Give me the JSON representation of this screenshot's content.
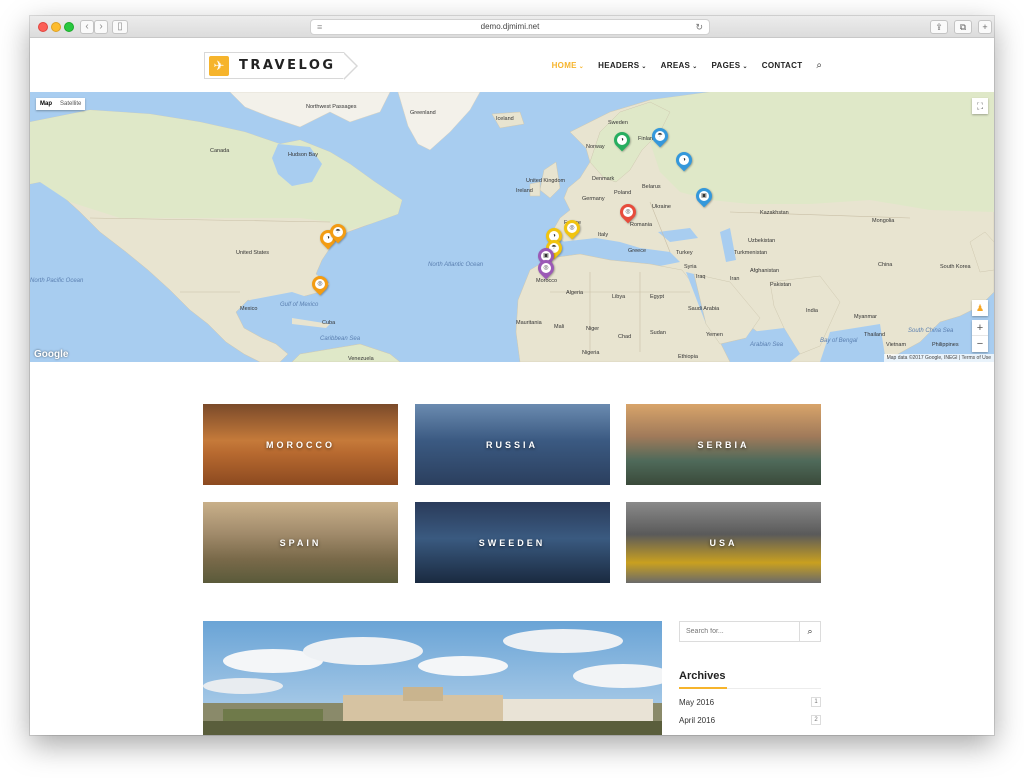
{
  "browser": {
    "url": "demo.djmimi.net"
  },
  "site": {
    "logo_text": "TRAVELOG",
    "nav": [
      {
        "label": "HOME",
        "has_menu": true,
        "active": true
      },
      {
        "label": "HEADERS",
        "has_menu": true,
        "active": false
      },
      {
        "label": "AREAS",
        "has_menu": true,
        "active": false
      },
      {
        "label": "PAGES",
        "has_menu": true,
        "active": false
      },
      {
        "label": "CONTACT",
        "has_menu": false,
        "active": false
      }
    ],
    "accent_color": "#f6b42c"
  },
  "map": {
    "type_controls": [
      "Map",
      "Satellite"
    ],
    "selected_type": "Map",
    "google_label": "Google",
    "credits": "Map data ©2017 Google, INEGI | Terms of Use",
    "labels": {
      "greenland": "Greenland",
      "iceland": "Iceland",
      "canada": "Canada",
      "hudson_bay": "Hudson Bay",
      "united_states": "United States",
      "mexico": "Mexico",
      "cuba": "Cuba",
      "venezuela": "Venezuela",
      "north_atlantic": "North Atlantic Ocean",
      "north_pacific": "North Pacific Ocean",
      "sweden": "Sweden",
      "finland": "Finland",
      "norway": "Norway",
      "united_kingdom": "United Kingdom",
      "ireland": "Ireland",
      "germany": "Germany",
      "poland": "Poland",
      "belarus": "Belarus",
      "ukraine": "Ukraine",
      "france": "France",
      "italy": "Italy",
      "romania": "Romania",
      "greece": "Greece",
      "turkey": "Turkey",
      "kazakhstan": "Kazakhstan",
      "mongolia": "Mongolia",
      "china": "China",
      "south_korea": "South Korea",
      "uzbekistan": "Uzbekistan",
      "turkmenistan": "Turkmenistan",
      "afghanistan": "Afghanistan",
      "pakistan": "Pakistan",
      "iran": "Iran",
      "iraq": "Iraq",
      "syria": "Syria",
      "india": "India",
      "saudi_arabia": "Saudi Arabia",
      "egypt": "Egypt",
      "libya": "Libya",
      "algeria": "Algeria",
      "morocco": "Morocco",
      "mauritania": "Mauritania",
      "mali": "Mali",
      "niger": "Niger",
      "chad": "Chad",
      "sudan": "Sudan",
      "nigeria": "Nigeria",
      "ethiopia": "Ethiopia",
      "yemen": "Yemen",
      "arabian_sea": "Arabian Sea",
      "bay_of_bengal": "Bay of Bengal",
      "gulf_of_mexico": "Gulf of Mexico",
      "caribbean": "Caribbean Sea",
      "myanmar": "Myanmar",
      "thailand": "Thailand",
      "vietnam": "Vietnam",
      "philippines": "Philippines",
      "south_china_sea": "South China Sea",
      "northwest_passages": "Northwest Passages",
      "denmark": "Denmark"
    },
    "pins": [
      {
        "color": "#f39c12",
        "glyph": "◑"
      },
      {
        "color": "#f39c12",
        "glyph": "☂"
      },
      {
        "color": "#f39c12",
        "glyph": "◎"
      },
      {
        "color": "#27ae60",
        "glyph": "◑"
      },
      {
        "color": "#3498db",
        "glyph": "☂"
      },
      {
        "color": "#3498db",
        "glyph": "◑"
      },
      {
        "color": "#3498db",
        "glyph": "▣"
      },
      {
        "color": "#e74c3c",
        "glyph": "◎"
      },
      {
        "color": "#f1c40f",
        "glyph": "◎"
      },
      {
        "color": "#f1c40f",
        "glyph": "◑"
      },
      {
        "color": "#f1c40f",
        "glyph": "☂"
      },
      {
        "color": "#9b59b6",
        "glyph": "▣"
      },
      {
        "color": "#9b59b6",
        "glyph": "◎"
      }
    ]
  },
  "destinations": [
    {
      "label": "MOROCCO"
    },
    {
      "label": "RUSSIA"
    },
    {
      "label": "SERBIA"
    },
    {
      "label": "SPAIN"
    },
    {
      "label": "SWEEDEN"
    },
    {
      "label": "USA"
    }
  ],
  "sidebar": {
    "search_placeholder": "Search for...",
    "archives_title": "Archives",
    "archives": [
      {
        "label": "May 2016",
        "count": "1"
      },
      {
        "label": "April 2016",
        "count": "2"
      }
    ]
  }
}
